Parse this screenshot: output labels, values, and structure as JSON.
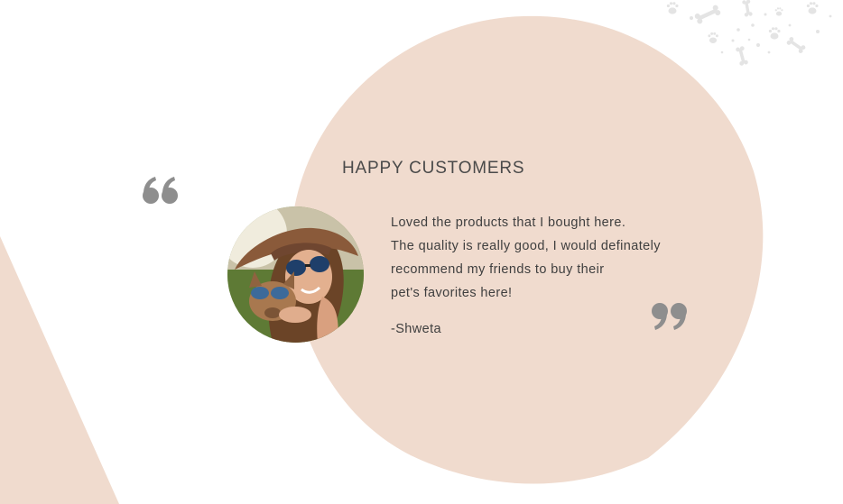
{
  "testimonial_section": {
    "title": "HAPPY CUSTOMERS",
    "quote_lines": [
      "Loved the products that I bought here.",
      "The quality is really good, I would definately",
      "recommend my friends to buy their",
      "pet's favorites here!"
    ],
    "author": "-Shweta"
  },
  "icons": {
    "open_quote": "quote-open-icon",
    "close_quote": "quote-close-icon",
    "pattern": "paw-bone-pattern"
  },
  "colors": {
    "circle_background": "#f0dbce",
    "quote_mark": "#8e8e8e",
    "pattern": "#e4e4e4",
    "text": "#3f3f3f",
    "title": "#4a4a4a"
  }
}
